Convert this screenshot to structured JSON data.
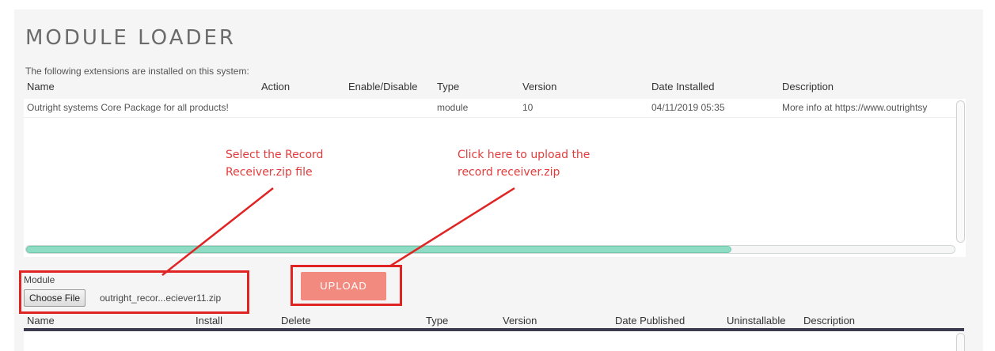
{
  "page": {
    "title": "MODULE LOADER",
    "subtitle": "The following extensions are installed on this system:"
  },
  "installed_table": {
    "headers": [
      "Name",
      "Action",
      "Enable/Disable",
      "Type",
      "Version",
      "Date Installed",
      "Description"
    ],
    "rows": [
      {
        "name": "Outright systems Core Package for all products!",
        "action": "",
        "enable_disable": "",
        "type": "module",
        "version": "10",
        "date_installed": "04/11/2019 05:35",
        "description": "More info at https://www.outrightsy"
      }
    ],
    "scroll_progress": 0.76
  },
  "annotations": {
    "select_note": [
      "Select the Record",
      "Receiver.zip file"
    ],
    "upload_note": [
      "Click here to upload the",
      "record receiver.zip"
    ],
    "color": "#e02424"
  },
  "upload_form": {
    "module_label": "Module",
    "choose_file_label": "Choose File",
    "file_name": "outright_recor...eciever11.zip",
    "upload_label": "UPLOAD",
    "upload_color": "#f28a80"
  },
  "package_table": {
    "headers": [
      "Name",
      "Install",
      "Delete",
      "Type",
      "Version",
      "Date Published",
      "Uninstallable",
      "Description"
    ]
  }
}
